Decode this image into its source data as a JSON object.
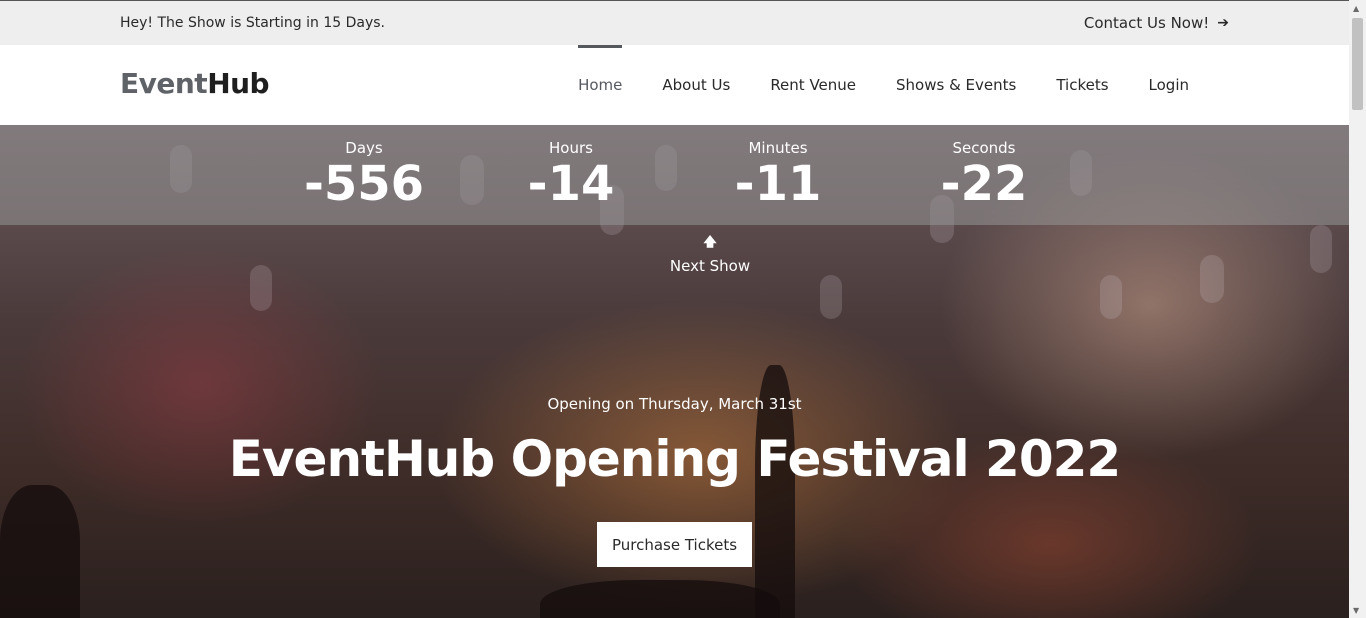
{
  "topbar": {
    "announcement": "Hey! The Show is Starting in 15 Days.",
    "contact_label": "Contact Us Now!",
    "contact_icon": "arrow-right-icon"
  },
  "header": {
    "logo_part1": "Event",
    "logo_part2": "Hub",
    "nav": [
      {
        "label": "Home",
        "active": true
      },
      {
        "label": "About Us"
      },
      {
        "label": "Rent Venue"
      },
      {
        "label": "Shows & Events"
      },
      {
        "label": "Tickets"
      },
      {
        "label": "Login"
      }
    ]
  },
  "countdown": {
    "days_label": "Days",
    "days_value": "-556",
    "hours_label": "Hours",
    "hours_value": "-14",
    "minutes_label": "Minutes",
    "minutes_value": "-11",
    "seconds_label": "Seconds",
    "seconds_value": "-22"
  },
  "next_show": {
    "icon": "arrow-up-icon",
    "label": "Next Show"
  },
  "hero": {
    "subtitle": "Opening on Thursday, March 31st",
    "title": "EventHub Opening Festival 2022",
    "cta_label": "Purchase Tickets"
  },
  "colors": {
    "topbar_bg": "#eeeeee",
    "nav_active": "#55595e",
    "countdown_band": "rgba(150,150,150,0.55)"
  }
}
